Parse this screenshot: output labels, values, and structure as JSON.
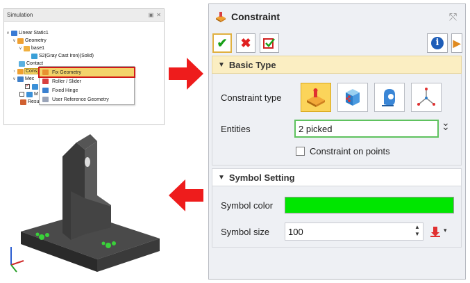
{
  "simulation": {
    "title": "Simulation",
    "tree": [
      {
        "label": "Linear Static1"
      },
      {
        "label": "Geometry"
      },
      {
        "label": "base1"
      },
      {
        "label": "S2(Gray Cast Iron)(Solid)"
      },
      {
        "label": "Contact"
      },
      {
        "label": "Cons"
      },
      {
        "label": "Mec"
      },
      {
        "label": "M"
      },
      {
        "label": "Resu"
      }
    ],
    "context_menu": [
      {
        "label": "Fix Geometry"
      },
      {
        "label": "Roller / Slider"
      },
      {
        "label": "Fixed Hinge"
      },
      {
        "label": "User Reference Geometry"
      }
    ]
  },
  "dialog": {
    "title": "Constraint",
    "basic_type": {
      "header": "Basic Type",
      "constraint_type_label": "Constraint type",
      "entities_label": "Entities",
      "entities_value": "2 picked",
      "constraint_on_points_label": "Constraint on points"
    },
    "symbol_setting": {
      "header": "Symbol Setting",
      "symbol_color_label": "Symbol color",
      "symbol_color": "#00e600",
      "symbol_size_label": "Symbol size",
      "symbol_size_value": "100"
    }
  },
  "colors": {
    "arrow": "#ee1c1c",
    "highlight": "#f3d36a",
    "accent_border": "#d01818"
  }
}
